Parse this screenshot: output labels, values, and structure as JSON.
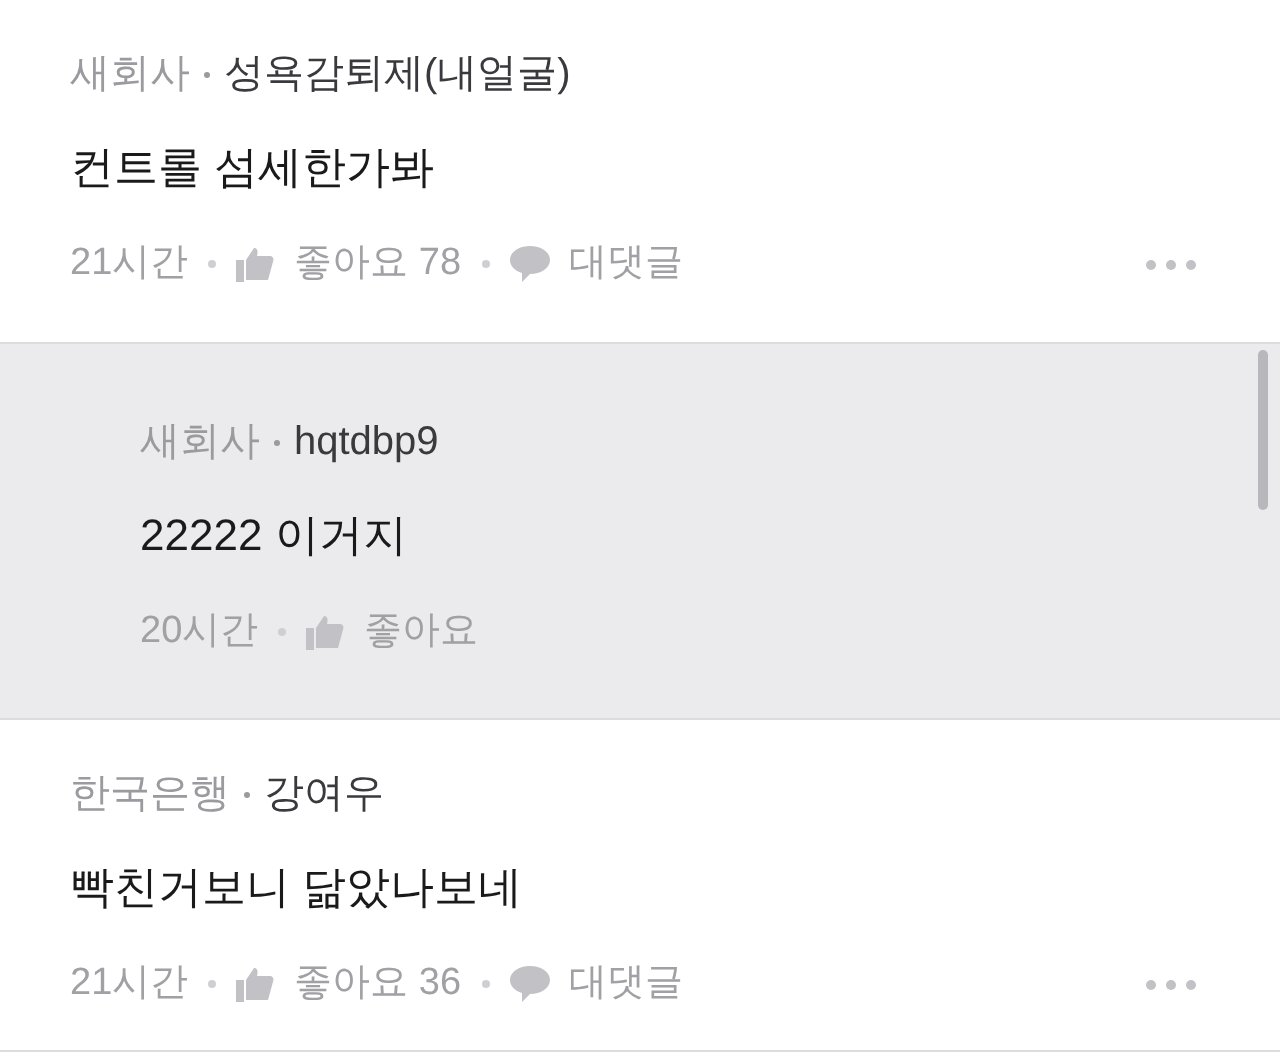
{
  "comments": [
    {
      "kind": "comment",
      "company": "새회사",
      "author": "성욕감퇴제(내얼굴)",
      "text": "컨트롤 섬세한가봐",
      "time": "21시간",
      "like_label": "좋아요 78",
      "reply_label": "대댓글",
      "more": true
    },
    {
      "kind": "reply",
      "company": "새회사",
      "author": "hqtdbp9",
      "text": "22222 이거지",
      "time": "20시간",
      "like_label": "좋아요",
      "more": false
    },
    {
      "kind": "comment",
      "company": "한국은행",
      "author": "강여우",
      "text": "빡친거보니 닮았나보네",
      "time": "21시간",
      "like_label": "좋아요 36",
      "reply_label": "대댓글",
      "more": true
    }
  ]
}
